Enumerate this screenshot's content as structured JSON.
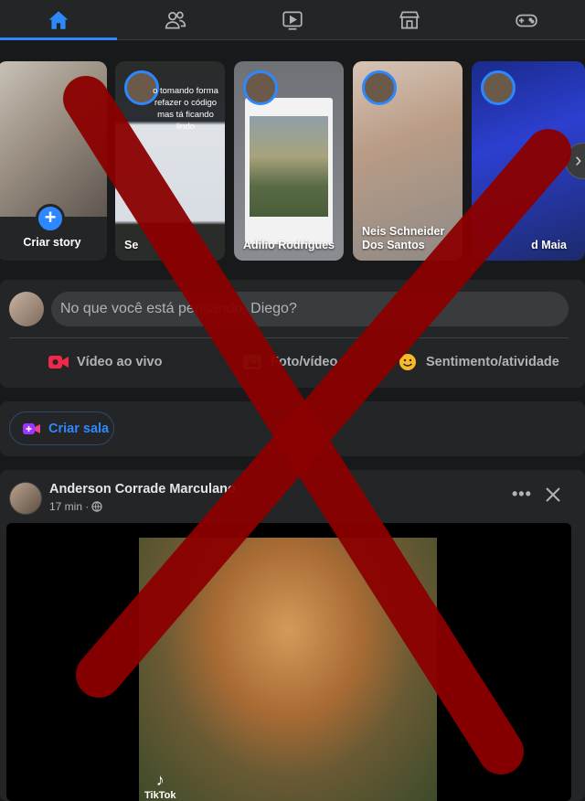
{
  "topnav": {
    "tabs": [
      {
        "name": "home-icon",
        "active": true
      },
      {
        "name": "friends-icon",
        "active": false
      },
      {
        "name": "watch-icon",
        "active": false
      },
      {
        "name": "marketplace-icon",
        "active": false
      },
      {
        "name": "gaming-icon",
        "active": false
      }
    ],
    "accent": "#2d88ff"
  },
  "stories": {
    "create_label": "Criar story",
    "create_plus": "+",
    "items": [
      {
        "label": "Se",
        "caption": "o tomando forma refazer o código mas tá ficando lindo"
      },
      {
        "label": "Adilio Rodrigues"
      },
      {
        "label": "Neis Schneider Dos Santos"
      },
      {
        "label": "d Maia"
      }
    ]
  },
  "composer": {
    "placeholder": "No que você está pensando, Diego?",
    "actions": [
      {
        "label": "Vídeo ao vivo",
        "icon": "live-video-icon",
        "color": "#f02849"
      },
      {
        "label": "Foto/vídeo",
        "icon": "photo-icon",
        "color": "#45bd62"
      },
      {
        "label": "Sentimento/atividade",
        "icon": "feeling-icon",
        "color": "#f7b928"
      }
    ]
  },
  "rooms": {
    "button_label": "Criar sala"
  },
  "post": {
    "author": "Anderson Corrade Marculano",
    "time": "17 min ·",
    "more": "•••",
    "watermark": "TikTok"
  },
  "overlay": {
    "color": "#8b0000"
  }
}
